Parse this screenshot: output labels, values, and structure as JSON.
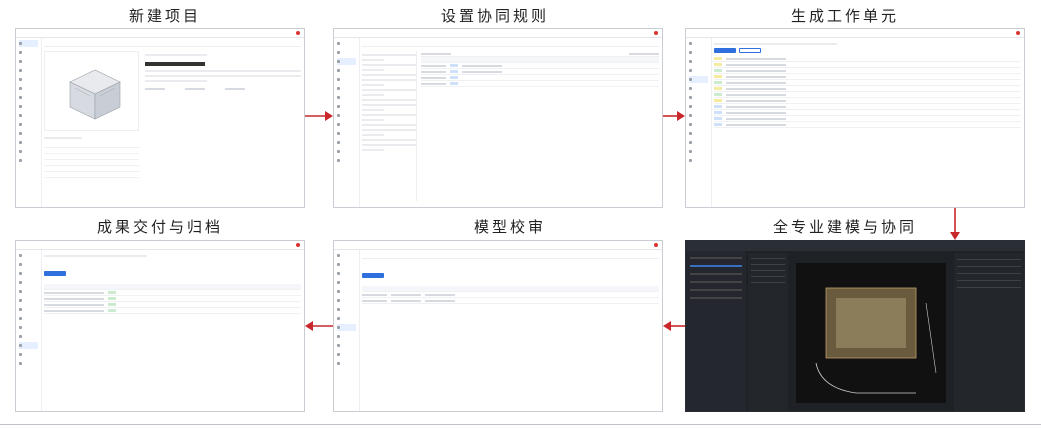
{
  "steps": {
    "s1": "新建项目",
    "s2": "设置协同规则",
    "s3": "生成工作单元",
    "s4": "全专业建模与协同",
    "s5": "模型校审",
    "s6": "成果交付与归档"
  },
  "colors": {
    "arrow": "#c8282b",
    "accent": "#2f6fde"
  }
}
